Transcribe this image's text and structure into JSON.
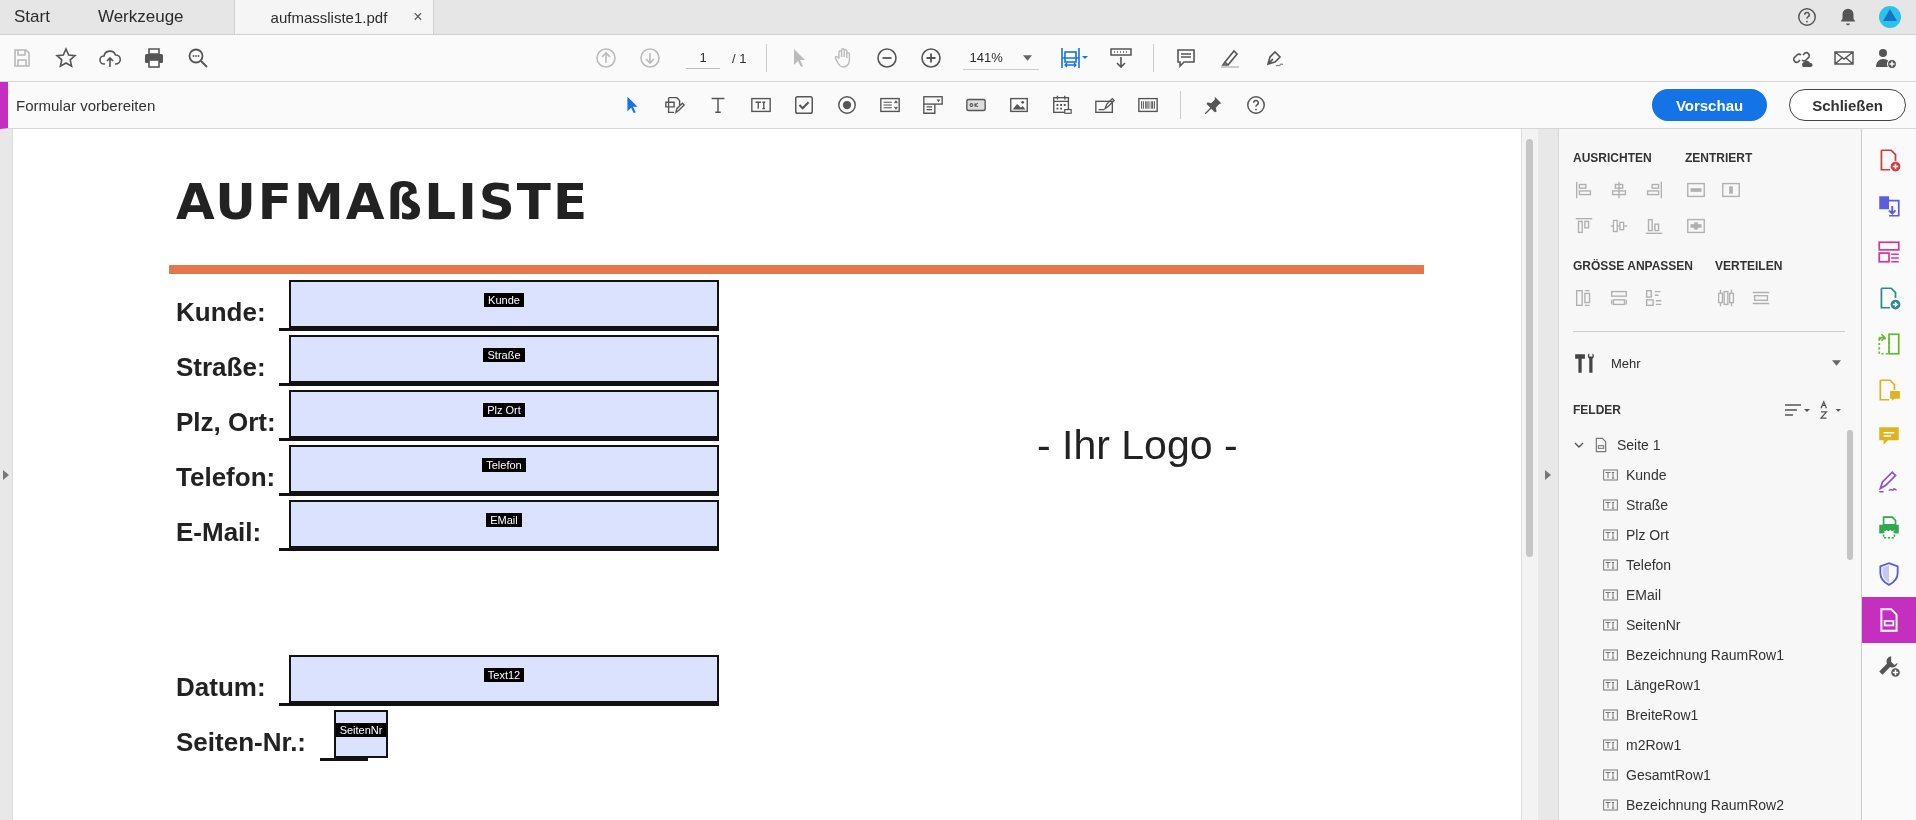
{
  "tabs": [
    {
      "label": "Start",
      "selected": false
    },
    {
      "label": "Werkzeuge",
      "selected": false
    },
    {
      "label": "aufmassliste1.pdf",
      "selected": true,
      "close": "×"
    }
  ],
  "toolbar": {
    "page_current": "1",
    "page_total": "/ 1",
    "zoom": "141%"
  },
  "form_toolbar": {
    "title": "Formular vorbereiten",
    "buttons": [
      {
        "label": "Vorschau",
        "kind": "primary"
      },
      {
        "label": "Schließen",
        "kind": "secondary"
      }
    ]
  },
  "document": {
    "title": "AUFMAßLISTE",
    "fields": [
      {
        "label": "Kunde:",
        "name": "Kunde",
        "kind": "wide"
      },
      {
        "label": "Straße:",
        "name": "Straße",
        "kind": "wide"
      },
      {
        "label": "Plz, Ort:",
        "name": "Plz Ort",
        "kind": "wide"
      },
      {
        "label": "Telefon:",
        "name": "Telefon",
        "kind": "wide"
      },
      {
        "label": "E-Mail:",
        "name": "EMail",
        "kind": "wide"
      },
      {
        "label": "Datum:",
        "name": "Text12",
        "kind": "wide",
        "spaced": true
      },
      {
        "label": "Seiten-Nr.:",
        "name": "SeitenNr",
        "kind": "small"
      }
    ],
    "logo_placeholder": "- Ihr Logo -"
  },
  "panel": {
    "align_heading": "AUSRICHTEN",
    "center_heading": "ZENTRIERT",
    "resize_heading": "GRÖSSE ANPASSEN",
    "distribute_heading": "VERTEILEN",
    "more": "Mehr",
    "fields_heading": "FELDER",
    "tree": [
      {
        "label": "Seite 1",
        "expanded": true,
        "children": [
          {
            "label": "Kunde"
          },
          {
            "label": "Straße"
          },
          {
            "label": "Plz Ort"
          },
          {
            "label": "Telefon"
          },
          {
            "label": "EMail"
          },
          {
            "label": "SeitenNr"
          },
          {
            "label": "Bezeichnung RaumRow1"
          },
          {
            "label": "LängeRow1"
          },
          {
            "label": "BreiteRow1"
          },
          {
            "label": "m2Row1"
          },
          {
            "label": "GesamtRow1"
          },
          {
            "label": "Bezeichnung RaumRow2"
          }
        ]
      }
    ]
  },
  "tool_rail": [
    {
      "kind": "create",
      "selected": false
    },
    {
      "kind": "export",
      "selected": false
    },
    {
      "kind": "organize",
      "selected": false
    },
    {
      "kind": "send",
      "selected": false
    },
    {
      "kind": "compare",
      "selected": false
    },
    {
      "kind": "review",
      "selected": false
    },
    {
      "kind": "comment",
      "selected": false
    },
    {
      "kind": "sign",
      "selected": false
    },
    {
      "kind": "print",
      "selected": false
    },
    {
      "kind": "protect",
      "selected": false
    },
    {
      "kind": "form",
      "selected": true
    },
    {
      "kind": "more",
      "selected": false
    }
  ]
}
